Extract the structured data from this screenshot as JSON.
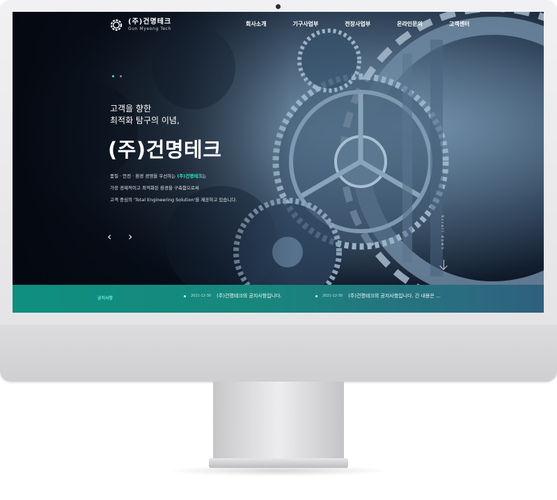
{
  "brand": {
    "name": "(주)건명테크",
    "subtitle": "Gun Myeong Tech"
  },
  "nav": {
    "items": [
      "회사소개",
      "기구사업부",
      "전장사업부",
      "온라인문의",
      "고객센터"
    ]
  },
  "hero": {
    "tagline_line1": "고객을 향한",
    "tagline_line2": "최적화 탐구의 이념,",
    "headline": "(주)건명테크",
    "desc_line1_before": "품질 · 안전 · 환경 경영을 우선하는 ",
    "desc_line1_highlight": "(주)건명테크",
    "desc_line1_after": "는",
    "desc_line2": "가장 경제적이고 최적화된 환경을 구축함으로써",
    "desc_line3": "고객 중심의 'Total Engineering Solution'을 제공하고 있습니다.",
    "prev_arrow": "‹",
    "next_arrow": "›",
    "scroll_label": "Scroll down",
    "slide_count": 2,
    "active_slide": 1
  },
  "notice": {
    "title": "공지사항",
    "items": [
      {
        "date": "2021-12-30",
        "text": "(주)건명테크의 공지사항입니다."
      },
      {
        "date": "2021-12-30",
        "text": "(주)건명테크의 공지사항입니다. 긴 내용은 ..."
      }
    ]
  },
  "colors": {
    "accent": "#22d3b6",
    "notice_bar": "#17877d",
    "hero_dark": "#070c15"
  },
  "icons": {
    "logo": "gear-logo-icon",
    "prev": "chevron-left-icon",
    "next": "chevron-right-icon",
    "scroll": "arrow-down-icon"
  }
}
